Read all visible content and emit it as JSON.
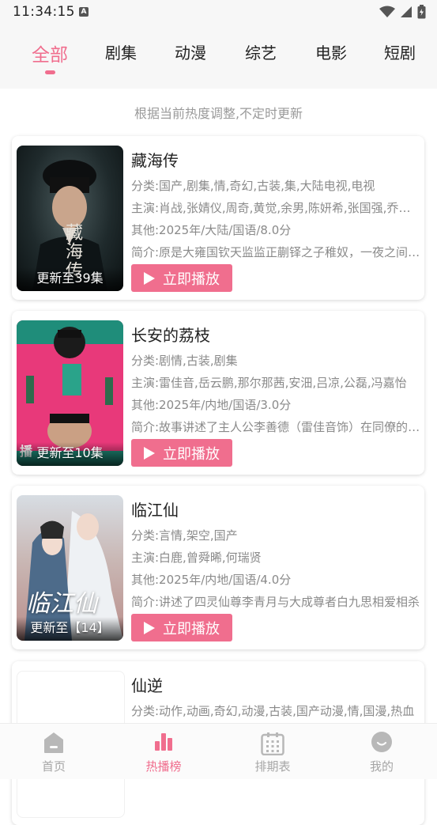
{
  "status": {
    "time": "11:34:15",
    "notif": "A"
  },
  "tabs": [
    {
      "label": "全部",
      "active": true
    },
    {
      "label": "剧集"
    },
    {
      "label": "动漫"
    },
    {
      "label": "综艺"
    },
    {
      "label": "电影"
    },
    {
      "label": "短剧"
    }
  ],
  "subtitle": "根据当前热度调整,不定时更新",
  "play_label": "立即播放",
  "items": [
    {
      "title": "藏海传",
      "category": "分类:国产,剧集,情,奇幻,古装,集,大陆电视,电视",
      "cast": "主演:肖战,张婧仪,周奇,黄觉,余男,陈妍希,张国强,乔振宇",
      "other": "其他:2025年/大陆/国语/8.0分",
      "intro": "简介:原是大雍国钦天监监正蒯铎之子稚奴，一夜之间家破人亡",
      "badge": "更新至39集",
      "poster_text": "藏海传"
    },
    {
      "title": "长安的荔枝",
      "category": "分类:剧情,古装,剧集",
      "cast": "主演:雷佳音,岳云鹏,那尔那茜,安沺,吕凉,公磊,冯嘉怡",
      "other": "其他:2025年/内地/国语/3.0分",
      "intro": "简介:故事讲述了主人公李善德（雷佳音饰）在同僚的欺压下",
      "badge": "更新至10集",
      "poster_text": "播"
    },
    {
      "title": "临江仙",
      "category": "分类:言情,架空,国产",
      "cast": "主演:白鹿,曾舜晞,何瑞贤",
      "other": "其他:2025年/内地/国语/4.0分",
      "intro": "简介:讲述了四灵仙尊李青月与大成尊者白九思相爱相杀",
      "badge": "更新至【14】",
      "poster_text": "临江仙"
    },
    {
      "title": "仙逆",
      "category": "分类:动作,动画,奇幻,动漫,古装,国产动漫,情,国漫,热血"
    }
  ],
  "bottom_nav": [
    {
      "label": "首页",
      "icon": "home-icon"
    },
    {
      "label": "热播榜",
      "icon": "chart-icon",
      "active": true
    },
    {
      "label": "排期表",
      "icon": "calendar-icon"
    },
    {
      "label": "我的",
      "icon": "profile-icon"
    }
  ],
  "colors": {
    "accent": "#f06e8e",
    "muted": "#8a8a8a"
  }
}
